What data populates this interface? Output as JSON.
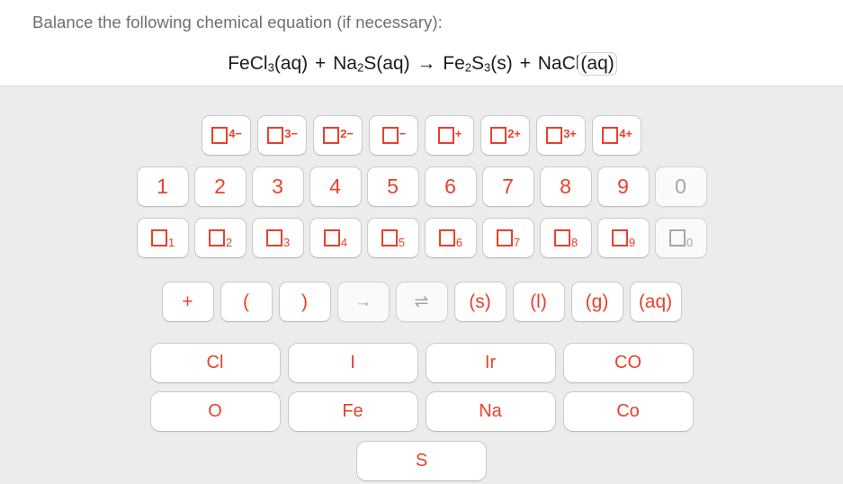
{
  "header": {
    "prompt": "Balance the following chemical equation (if necessary):",
    "equation": {
      "plain": "FeCl3(aq) + Na2S(aq) → Fe2S3(s) + NaCl(aq)",
      "tokens": [
        {
          "text": "FeCl",
          "type": "text"
        },
        {
          "text": "3",
          "type": "subscript"
        },
        {
          "text": "(aq)",
          "type": "text"
        },
        {
          "text": "+",
          "type": "operator"
        },
        {
          "text": "Na",
          "type": "text"
        },
        {
          "text": "2",
          "type": "subscript"
        },
        {
          "text": "S(aq)",
          "type": "text"
        },
        {
          "text": "→",
          "type": "operator"
        },
        {
          "text": "Fe",
          "type": "text"
        },
        {
          "text": "2",
          "type": "subscript"
        },
        {
          "text": "S",
          "type": "text"
        },
        {
          "text": "3",
          "type": "subscript"
        },
        {
          "text": "(s)",
          "type": "text"
        },
        {
          "text": "+",
          "type": "operator"
        },
        {
          "text": "NaCl",
          "type": "text"
        },
        {
          "text": "(aq)",
          "type": "text",
          "focused": true
        }
      ]
    }
  },
  "colors": {
    "key_text_red": "#e8412b",
    "key_text_disabled": "#a6a6a6",
    "key_background": "#ffffff",
    "key_border": "#c9c9c9",
    "panel_background": "#ececec",
    "header_background": "#ffffff",
    "prompt_text": "#6e6e6e",
    "equation_text": "#1b1b1b"
  },
  "keypad": {
    "charges": [
      {
        "label": "□⁴⁻",
        "charge": "4-",
        "sup": "4−",
        "disabled": false
      },
      {
        "label": "□³⁻",
        "charge": "3-",
        "sup": "3−",
        "disabled": false
      },
      {
        "label": "□²⁻",
        "charge": "2-",
        "sup": "2−",
        "disabled": false
      },
      {
        "label": "□⁻",
        "charge": "-",
        "sup": "−",
        "disabled": false
      },
      {
        "label": "□⁺",
        "charge": "+",
        "sup": "+",
        "disabled": false
      },
      {
        "label": "□²⁺",
        "charge": "2+",
        "sup": "2+",
        "disabled": false
      },
      {
        "label": "□³⁺",
        "charge": "3+",
        "sup": "3+",
        "disabled": false
      },
      {
        "label": "□⁴⁺",
        "charge": "4+",
        "sup": "4+",
        "disabled": false
      }
    ],
    "digits": [
      {
        "label": "1",
        "disabled": false
      },
      {
        "label": "2",
        "disabled": false
      },
      {
        "label": "3",
        "disabled": false
      },
      {
        "label": "4",
        "disabled": false
      },
      {
        "label": "5",
        "disabled": false
      },
      {
        "label": "6",
        "disabled": false
      },
      {
        "label": "7",
        "disabled": false
      },
      {
        "label": "8",
        "disabled": false
      },
      {
        "label": "9",
        "disabled": false
      },
      {
        "label": "0",
        "disabled": true
      }
    ],
    "subscripts": [
      {
        "label": "□₁",
        "index": "1",
        "disabled": false
      },
      {
        "label": "□₂",
        "index": "2",
        "disabled": false
      },
      {
        "label": "□₃",
        "index": "3",
        "disabled": false
      },
      {
        "label": "□₄",
        "index": "4",
        "disabled": false
      },
      {
        "label": "□₅",
        "index": "5",
        "disabled": false
      },
      {
        "label": "□₆",
        "index": "6",
        "disabled": false
      },
      {
        "label": "□₇",
        "index": "7",
        "disabled": false
      },
      {
        "label": "□₈",
        "index": "8",
        "disabled": false
      },
      {
        "label": "□₉",
        "index": "9",
        "disabled": false
      },
      {
        "label": "□₀",
        "index": "0",
        "disabled": true
      }
    ],
    "operators": [
      {
        "label": "+",
        "name": "plus",
        "disabled": false
      },
      {
        "label": "(",
        "name": "open-paren",
        "disabled": false
      },
      {
        "label": ")",
        "name": "close-paren",
        "disabled": false
      },
      {
        "label": "→",
        "name": "yields-arrow",
        "disabled": true
      },
      {
        "label": "⇌",
        "name": "equilibrium-arrow",
        "disabled": true
      },
      {
        "label": "(s)",
        "name": "state-solid",
        "disabled": false
      },
      {
        "label": "(l)",
        "name": "state-liquid",
        "disabled": false
      },
      {
        "label": "(g)",
        "name": "state-gas",
        "disabled": false
      },
      {
        "label": "(aq)",
        "name": "state-aqueous",
        "disabled": false
      }
    ],
    "elements": [
      [
        {
          "label": "Cl",
          "disabled": false
        },
        {
          "label": "I",
          "disabled": false
        },
        {
          "label": "Ir",
          "disabled": false
        },
        {
          "label": "CO",
          "disabled": false
        }
      ],
      [
        {
          "label": "O",
          "disabled": false
        },
        {
          "label": "Fe",
          "disabled": false
        },
        {
          "label": "Na",
          "disabled": false
        },
        {
          "label": "Co",
          "disabled": false
        }
      ],
      [
        {
          "label": "S",
          "disabled": false
        }
      ]
    ]
  }
}
